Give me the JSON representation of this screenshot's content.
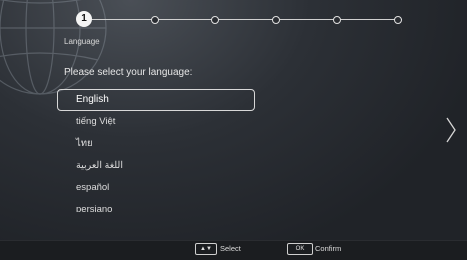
{
  "wizard": {
    "current_step_number": "1",
    "total_steps": 6,
    "current_step_label": "Language"
  },
  "prompt": "Please select your language:",
  "languages": [
    {
      "label": "English",
      "selected": true
    },
    {
      "label": "tiếng Việt",
      "selected": false
    },
    {
      "label": "ไทย",
      "selected": false
    },
    {
      "label": "اللغة العربية",
      "selected": false
    },
    {
      "label": "español",
      "selected": false
    },
    {
      "label": "persiano",
      "selected": false
    }
  ],
  "icons": {
    "background": "globe-icon",
    "next": "chevron-right-icon",
    "select_key": "up-down-arrows-icon"
  },
  "footer": {
    "select_key_glyph": "▲▼",
    "select_label": "Select",
    "confirm_key": "OK",
    "confirm_label": "Confirm"
  }
}
